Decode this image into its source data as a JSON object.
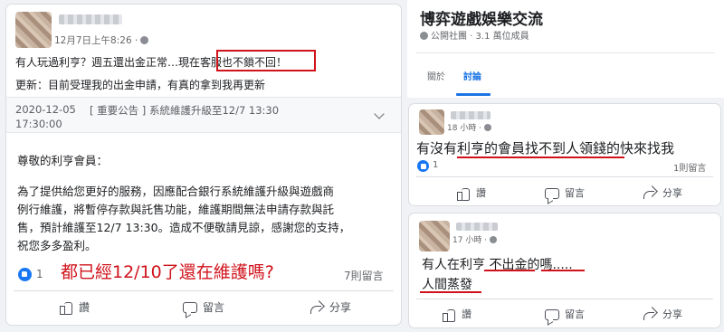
{
  "left_post": {
    "timestamp": "12月7日上午8:26 ·",
    "line1_prefix": "有人玩過利亨？週五還出金正常…現在",
    "line1_highlight": "客服也不鎖不回！",
    "line2": "更新：目前受理我的出金申請，有真的拿到我再更新",
    "notice_date": "2020-12-05",
    "notice_title": "[ 重要公告 ] 系統維護升級至12/7 13:30",
    "notice_time": "17:30:00",
    "notice_greeting": "尊敬的利亨會員：",
    "notice_body": [
      "為了提供給您更好的服務，因應配合銀行系統維護升級與遊戲商",
      "例行維護，將暫停存款與託售功能，維護期間無法申請存款與託",
      "售，預計維護至12/7 13:30。造成不便敬請見諒，感謝您的支持，",
      "祝您多多盈利。"
    ],
    "like_count": "1",
    "overlay_caption": "都已經12/10了還在維護嗎?",
    "comment_count": "7則留言",
    "actions": {
      "like": "讚",
      "comment": "留言",
      "share": "分享"
    }
  },
  "group": {
    "title": "博弈遊戲娛樂交流",
    "subtitle": "公開社團 · 3.1 萬位成員",
    "tabs": [
      "關於",
      "討論"
    ]
  },
  "post_a": {
    "timestamp": "18 小時 ·",
    "text": "有沒有利亨的會員找不到人領錢的快來找我",
    "like_count": "1",
    "comment_count": "1則留言",
    "actions": {
      "like": "讚",
      "comment": "留言",
      "share": "分享"
    }
  },
  "post_b": {
    "timestamp": "17 小時 ·",
    "line1": "有人在利亨 不出金的嗎.....",
    "line2": "人間蒸發",
    "actions": {
      "like": "讚",
      "comment": "留言",
      "share": "分享"
    }
  },
  "colors": {
    "accent": "#1877f2",
    "annotation_red": "#d0121b"
  }
}
